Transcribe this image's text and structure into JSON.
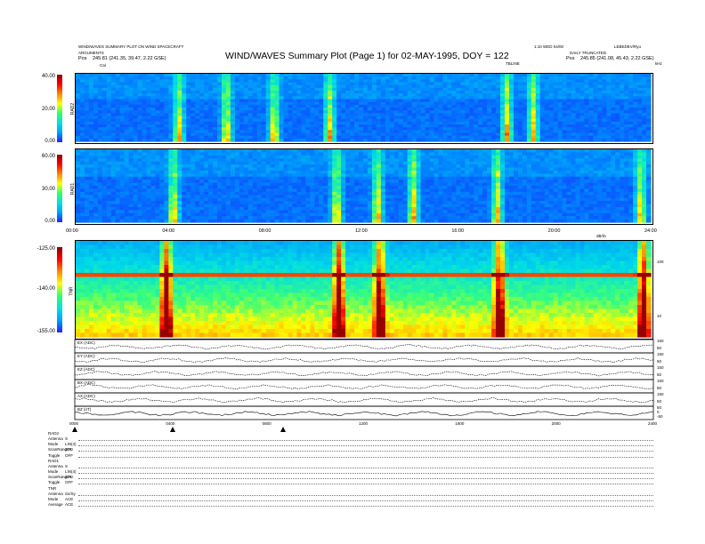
{
  "header": {
    "left_line1": "WIND/WAVES SUMMARY PLOT ON WIND SPACECRAFT",
    "left_line2": "ARGUMENTS",
    "left_line3_prefix": "Pos",
    "left_line3": "245.81 (241.35, 39.47, 2.22 GSE)",
    "right_line1": "1:10 WED 04/00",
    "right_line2": "LEBEDEV/Ryu",
    "right_line3": "DAILY TRUNCATED",
    "right_line3_prefix": "Pos",
    "right_line3_value": "245.85 (241.08, 45.43, 2.22 GSE)",
    "title": "WIND/WAVES Summary Plot (Page 1) for 02-MAY-1995, DOY = 122",
    "marker_cal": "Cal",
    "marker_top": "TBLINE",
    "corner_right": "kHz"
  },
  "colors": {
    "background_low": "#1030ff",
    "mid": "#00d8ff",
    "high": "#ffe400",
    "peak": "#ff0000",
    "axis": "#000000"
  },
  "chart_data": [
    {
      "type": "heatmap",
      "name": "RAD2",
      "ylabel": "RAD2",
      "yticks": [
        "40.00",
        "20.00",
        "0.00"
      ],
      "ylim": [
        0,
        40
      ],
      "x_range_hours": [
        0,
        24
      ],
      "bursts_hours": [
        4.2,
        6.2,
        8.2,
        10.5,
        17.9,
        19.0
      ]
    },
    {
      "type": "heatmap",
      "name": "RAD1",
      "ylabel": "RAD1",
      "yticks": [
        "60.00",
        "30.00",
        "0.00"
      ],
      "ylim": [
        0,
        60
      ],
      "x_range_hours": [
        0,
        24
      ],
      "xticks": [
        "00:00",
        "04:00",
        "08:00",
        "12:00",
        "16:00",
        "20:00",
        "24:00"
      ],
      "bursts_hours": [
        4.0,
        10.8,
        12.5,
        14.0,
        17.5,
        23.5
      ]
    },
    {
      "type": "heatmap",
      "name": "TNR",
      "ylabel": "TNR",
      "yticks": [
        "-125.00",
        "-140.00",
        "-155.00"
      ],
      "ylim": [
        -155,
        -125
      ],
      "x_range_hours": [
        0,
        24
      ],
      "right_ticks": [
        "100",
        "10"
      ],
      "right_label": "dB/rb",
      "bursts_hours": [
        3.7,
        10.9,
        12.6,
        17.6,
        23.6
      ]
    },
    {
      "type": "line",
      "name": "Channel traces",
      "x_range_hours": [
        0,
        24
      ],
      "xticks": [
        "0000",
        "0400",
        "0800",
        "1200",
        "1600",
        "2000",
        "2400"
      ],
      "series": [
        {
          "name": "EX (ADC)",
          "right_ticks": [
            "150",
            "50"
          ]
        },
        {
          "name": "EY (ADC)",
          "right_ticks": [
            "150",
            "50"
          ]
        },
        {
          "name": "EZ (ADC)",
          "right_ticks": [
            "150",
            "50"
          ]
        },
        {
          "name": "BX (ADC)",
          "right_ticks": [
            "150",
            "50"
          ]
        },
        {
          "name": "AX (ADC)",
          "right_ticks": [
            "150",
            "50"
          ]
        },
        {
          "name": "BZ (nT)",
          "right_ticks": [
            "50",
            "0",
            "-50"
          ]
        }
      ]
    }
  ],
  "status": {
    "sections": [
      {
        "title": "RAD2",
        "rows": [
          [
            "Antenna",
            "S"
          ],
          [
            "Mode",
            "LIN(4)"
          ],
          [
            "ScanRangeA",
            "STD"
          ],
          [
            "Toggle",
            "OFF"
          ]
        ]
      },
      {
        "title": "RAD1",
        "rows": [
          [
            "Antenna",
            "S"
          ],
          [
            "Mode",
            "LIN(4)"
          ],
          [
            "ScanRangeA",
            "STD"
          ],
          [
            "Toggle",
            "OFF"
          ]
        ]
      },
      {
        "title": "TNR",
        "rows": [
          [
            "Antenna",
            "Sx/Sy"
          ],
          [
            "Mode",
            "ACE"
          ],
          [
            "Average",
            "ACE"
          ]
        ]
      }
    ]
  }
}
